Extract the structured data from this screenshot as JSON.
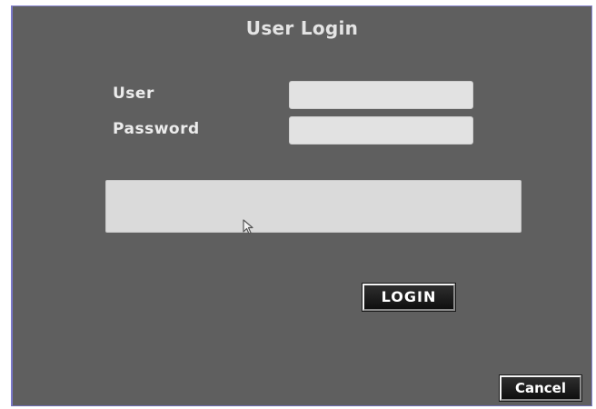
{
  "dialog": {
    "title": "User Login"
  },
  "form": {
    "user_label": "User",
    "user_value": "",
    "password_label": "Password",
    "password_value": ""
  },
  "message": {
    "text": ""
  },
  "buttons": {
    "login_label": "LOGIN",
    "cancel_label": "Cancel"
  },
  "icons": {
    "cursor": "mouse-pointer-icon"
  },
  "colors": {
    "panel_background": "#5f5f5f",
    "panel_border": "#7a78c8",
    "field_background": "#e2e2e2",
    "label_text": "#ececec",
    "button_background": "#1a1a1a"
  }
}
